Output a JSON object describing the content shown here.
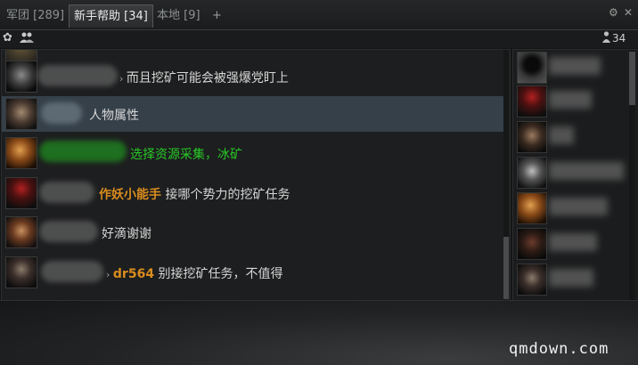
{
  "tabs": [
    {
      "label": "军团 [289]",
      "active": false
    },
    {
      "label": "新手帮助 [34]",
      "active": true
    },
    {
      "label": "本地 [9]",
      "active": false
    }
  ],
  "tab_add": "+",
  "window_controls": {
    "settings": "⚙",
    "close": "✕"
  },
  "toolbar": {
    "member_count": "34"
  },
  "messages": [
    {
      "sender": "",
      "text": "而且挖矿可能会被强爆党盯上",
      "highlighted": false
    },
    {
      "sender": "",
      "text": "人物属性",
      "highlighted": true
    },
    {
      "sender": "",
      "text": "选择资源采集，冰矿",
      "highlighted": false,
      "color": "#27c927"
    },
    {
      "sender": "作妖小能手",
      "text": "接哪个势力的挖矿任务",
      "highlighted": false
    },
    {
      "sender": "",
      "text": "好滴谢谢",
      "highlighted": false
    },
    {
      "sender": "dr564",
      "text": "别接挖矿任务，不值得",
      "highlighted": false
    }
  ],
  "watermark": "qmdown.com"
}
